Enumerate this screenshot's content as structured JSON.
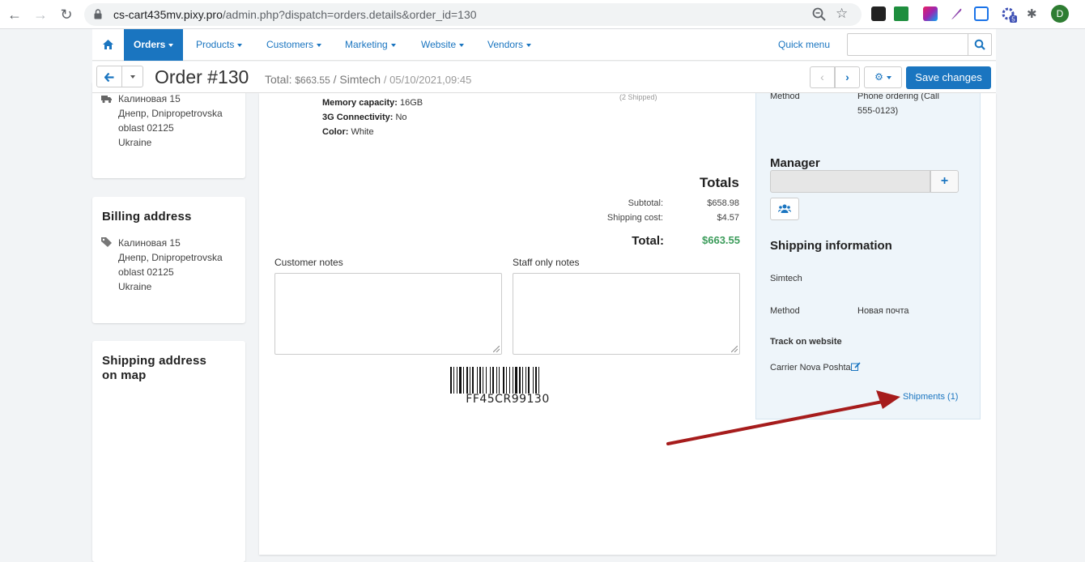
{
  "browser": {
    "url_host": "cs-cart435mv.pixy.pro",
    "url_path": "/admin.php?dispatch=orders.details&order_id=130",
    "profile_initial": "D",
    "ext_badge": "5"
  },
  "nav": {
    "items": [
      {
        "label": "Orders",
        "active": true
      },
      {
        "label": "Products"
      },
      {
        "label": "Customers"
      },
      {
        "label": "Marketing"
      },
      {
        "label": "Website"
      },
      {
        "label": "Vendors"
      }
    ],
    "quick_menu": "Quick menu"
  },
  "order": {
    "title": "Order #130",
    "total_label": "Total:",
    "total_value": "$663.55",
    "separator": "/",
    "vendor": "Simtech",
    "date": "/ 05/10/2021,09:45",
    "save_label": "Save changes"
  },
  "shipping_address": {
    "lines": [
      "Калиновая 15",
      "Днепр, Dnipropetrovska",
      "oblast 02125",
      "Ukraine"
    ]
  },
  "billing": {
    "title": "Billing address",
    "lines": [
      "Калиновая 15",
      "Днепр, Dnipropetrovska",
      "oblast 02125",
      "Ukraine"
    ]
  },
  "map": {
    "title_line1": "Shipping address",
    "title_line2": "on map"
  },
  "product": {
    "shipped_note": "(2 Shipped)",
    "specs": [
      {
        "label": "Memory capacity:",
        "value": "16GB"
      },
      {
        "label": "3G Connectivity:",
        "value": "No"
      },
      {
        "label": "Color:",
        "value": "White"
      }
    ]
  },
  "totals": {
    "heading": "Totals",
    "subtotal_label": "Subtotal:",
    "subtotal_value": "$658.98",
    "shipping_label": "Shipping cost:",
    "shipping_value": "$4.57",
    "total_label": "Total:",
    "total_value": "$663.55",
    "total_color": "#3c9c5b"
  },
  "notes": {
    "customer_label": "Customer notes",
    "staff_label": "Staff only notes"
  },
  "barcode": {
    "code": "FF45CR99130"
  },
  "sidebar": {
    "method_label": "Method",
    "method_value_line1": "Phone ordering (Call",
    "method_value_line2": "555-0123)",
    "manager_title": "Manager",
    "shipping_title": "Shipping information",
    "carrier_company": "Simtech",
    "ship_method_label": "Method",
    "ship_method_value": "Новая почта",
    "track_label": "Track on website",
    "carrier_text": "Carrier Nova Poshta",
    "shipments_link": "Shipments (1)"
  },
  "colors": {
    "accent": "#1a75c0",
    "arrow": "#a61c1c"
  }
}
